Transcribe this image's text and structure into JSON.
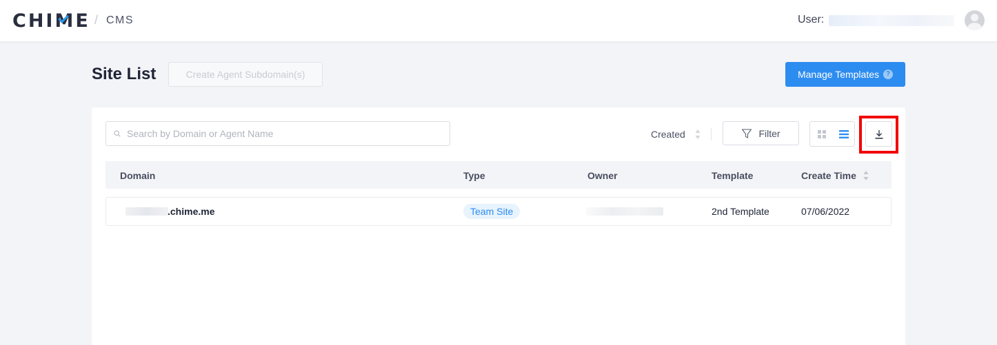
{
  "header": {
    "logo_prefix": "CHI",
    "logo_m": "M",
    "logo_suffix": "E",
    "separator": "/",
    "section": "CMS",
    "user_label": "User:"
  },
  "page": {
    "title": "Site List",
    "create_subdomain_label": "Create Agent Subdomain(s)",
    "manage_templates_label": "Manage Templates",
    "help_glyph": "?"
  },
  "toolbar": {
    "search_placeholder": "Search by Domain or Agent Name",
    "sort_label": "Created",
    "filter_label": "Filter",
    "active_view": "list",
    "highlight_color": "#f20000"
  },
  "table": {
    "columns": [
      "Domain",
      "Type",
      "Owner",
      "Template",
      "Create Time"
    ],
    "rows": [
      {
        "domain": ".chime.me",
        "type": "Team Site",
        "owner": "",
        "template": "2nd Template",
        "create_time": "07/06/2022"
      }
    ]
  },
  "colors": {
    "primary": "#2d8cf0",
    "background": "#f3f4f7",
    "text": "#202437"
  }
}
